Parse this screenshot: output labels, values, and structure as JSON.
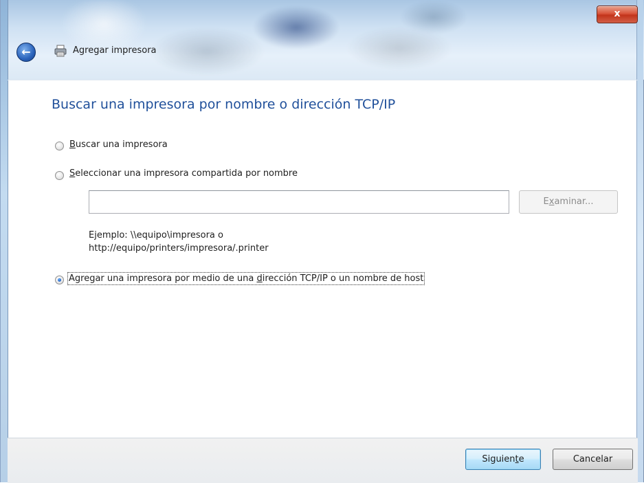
{
  "window": {
    "title": "Agregar impresora",
    "close_label": "x"
  },
  "page": {
    "heading": "Buscar una impresora por nombre o dirección TCP/IP"
  },
  "options": [
    {
      "pre": "",
      "u": "B",
      "post": "uscar una impresora",
      "checked": false
    },
    {
      "pre": "",
      "u": "S",
      "post": "eleccionar una impresora compartida por nombre",
      "checked": false
    },
    {
      "pre": "Agregar una impresora por medio de una ",
      "u": "d",
      "post": "irección TCP/IP o un nombre de host",
      "checked": true
    }
  ],
  "share": {
    "value": "",
    "browse_pre": "E",
    "browse_u": "x",
    "browse_post": "aminar...",
    "example_line1": "Ejemplo: \\\\equipo\\impresora o",
    "example_line2": "http://equipo/printers/impresora/.printer"
  },
  "footer": {
    "next_pre": "Siguien",
    "next_u": "t",
    "next_post": "e",
    "cancel": "Cancelar"
  },
  "colors": {
    "heading": "#1f4f9a",
    "next_border": "#3c7fb1"
  }
}
